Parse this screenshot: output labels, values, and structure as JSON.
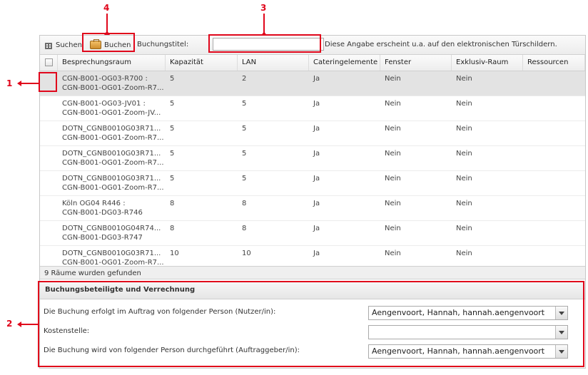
{
  "toolbar": {
    "search_label": "Suchen",
    "book_label": "Buchen",
    "title_label": "Buchungstitel:",
    "title_value": "",
    "note": "Diese Angabe erscheint u.a. auf den elektronischen Türschildern."
  },
  "columns": [
    "Besprechungsraum",
    "Kapazität",
    "LAN",
    "Cateringelemente",
    "Fenster",
    "Exklusiv-Raum",
    "Ressourcen"
  ],
  "rows": [
    {
      "line1": "CGN-B001-OG03-R700 :",
      "line2": "CGN-B001-OG01-Zoom-R7...",
      "kapazitaet": "5",
      "lan": "2",
      "catering": "Ja",
      "fenster": "Nein",
      "exklusiv": "Nein",
      "ressourcen": "",
      "checked": true
    },
    {
      "line1": "CGN-B001-OG03-JV01 :",
      "line2": "CGN-B001-OG01-Zoom-JV...",
      "kapazitaet": "5",
      "lan": "5",
      "catering": "Ja",
      "fenster": "Nein",
      "exklusiv": "Nein",
      "ressourcen": "",
      "checked": false
    },
    {
      "line1": "DOTN_CGNB0010G03R71...",
      "line2": "CGN-B001-OG01-Zoom-R7...",
      "kapazitaet": "5",
      "lan": "5",
      "catering": "Ja",
      "fenster": "Nein",
      "exklusiv": "Nein",
      "ressourcen": "",
      "checked": false
    },
    {
      "line1": "DOTN_CGNB0010G03R71...",
      "line2": "CGN-B001-OG01-Zoom-R7...",
      "kapazitaet": "5",
      "lan": "5",
      "catering": "Ja",
      "fenster": "Nein",
      "exklusiv": "Nein",
      "ressourcen": "",
      "checked": false
    },
    {
      "line1": "DOTN_CGNB0010G03R71...",
      "line2": "CGN-B001-OG01-Zoom-R7...",
      "kapazitaet": "5",
      "lan": "5",
      "catering": "Ja",
      "fenster": "Nein",
      "exklusiv": "Nein",
      "ressourcen": "",
      "checked": false
    },
    {
      "line1": "Köln OG04 R446 :",
      "line2": "CGN-B001-DG03-R746",
      "kapazitaet": "8",
      "lan": "8",
      "catering": "Ja",
      "fenster": "Nein",
      "exklusiv": "Nein",
      "ressourcen": "",
      "checked": false
    },
    {
      "line1": "DOTN_CGNB0010G04R74...",
      "line2": "CGN-B001-DG03-R747",
      "kapazitaet": "8",
      "lan": "8",
      "catering": "Ja",
      "fenster": "Nein",
      "exklusiv": "Nein",
      "ressourcen": "",
      "checked": false
    },
    {
      "line1": "DOTN_CGNB0010G03R71...",
      "line2": "CGN-B001-OG01-Zoom-R7...",
      "kapazitaet": "10",
      "lan": "10",
      "catering": "Ja",
      "fenster": "Nein",
      "exklusiv": "Nein",
      "ressourcen": "",
      "checked": false
    }
  ],
  "status": "9 Räume wurden gefunden",
  "billing": {
    "heading": "Buchungsbeteiligte und Verrechnung",
    "principal_label": "Die Buchung erfolgt im Auftrag von folgender Person (Nutzer/in):",
    "principal_value": "Aengenvoort, Hannah, hannah.aengenvoort",
    "cost_center_label": "Kostenstelle:",
    "cost_center_value": "",
    "executor_label": "Die Buchung wird von folgender Person durchgeführt (Auftraggeber/in):",
    "executor_value": "Aengenvoort, Hannah, hannah.aengenvoort"
  },
  "annotations": [
    "1",
    "2",
    "3",
    "4"
  ],
  "colors": {
    "annotation": "#e0061b",
    "selected_row": "#e3e3e3"
  }
}
